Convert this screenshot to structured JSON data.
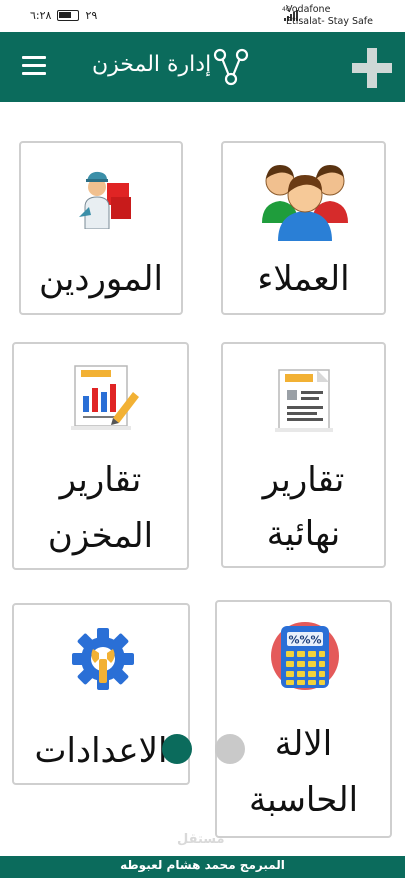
{
  "status_bar": {
    "time": "٦:٢٨",
    "battery": "٢٩",
    "carrier_1": "Vodafone",
    "carrier_2": "Etisalat- Stay Safe",
    "network": "4G"
  },
  "app_bar": {
    "title": "إدارة المخزن",
    "icons": [
      "menu-icon",
      "share-icon",
      "plus-icon"
    ]
  },
  "tiles": [
    {
      "label": "العملاء",
      "icon": "customers-group-icon"
    },
    {
      "label": "الموردين",
      "icon": "supplier-delivery-icon"
    },
    {
      "label": "تقارير نهائية",
      "line1": "تقارير",
      "line2": "نهائية",
      "icon": "final-report-document-icon"
    },
    {
      "label": "تقارير المخزن",
      "line1": "تقارير",
      "line2": "المخزن",
      "icon": "stock-report-chart-icon"
    },
    {
      "label": "الالة الحاسبة",
      "line1": "الالة",
      "line2": "الحاسبة",
      "icon": "calculator-icon",
      "calc_display": "%%%"
    },
    {
      "label": "الاعدادات",
      "icon": "settings-gear-wrench-icon"
    }
  ],
  "pager": {
    "active_index": 0,
    "count": 2,
    "active_color": "#0b6b5c",
    "inactive_color": "#c9c9c9"
  },
  "footer": {
    "text": "المبرمج محمد هشام لعبوطه"
  },
  "watermark": "مستقل",
  "colors": {
    "primary": "#0b6b5c",
    "tile_border": "#cfcfcf"
  }
}
